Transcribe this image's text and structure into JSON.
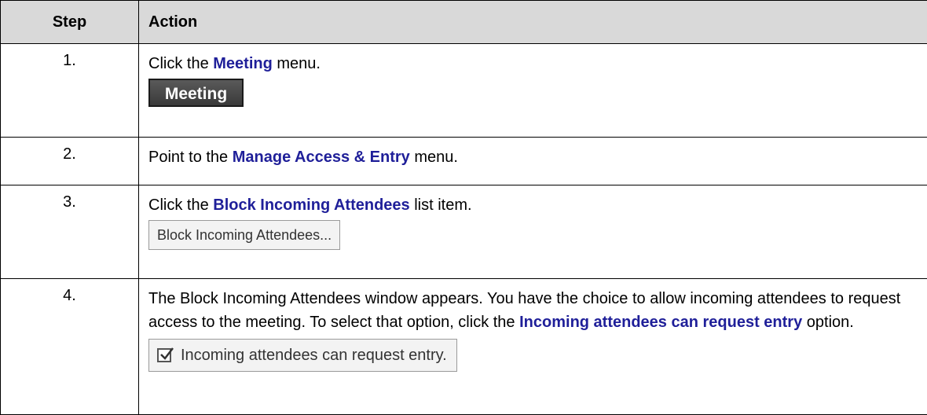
{
  "table": {
    "headers": {
      "step": "Step",
      "action": "Action"
    },
    "rows": [
      {
        "step": "1.",
        "pre": "Click the ",
        "highlight": "Meeting",
        "post": " menu.",
        "widget_label": "Meeting"
      },
      {
        "step": "2.",
        "pre": "Point to the ",
        "highlight": "Manage Access & Entry",
        "post": " menu."
      },
      {
        "step": "3.",
        "pre": "Click the ",
        "highlight": "Block Incoming Attendees",
        "post": " list item.",
        "widget_label": "Block Incoming Attendees..."
      },
      {
        "step": "4.",
        "pre": "The Block Incoming Attendees window appears.  You have the choice to allow incoming attendees to request access to the meeting.  To select that option, click the ",
        "highlight": "Incoming attendees can request entry",
        "post": " option.",
        "widget_label": "Incoming attendees can request entry.",
        "widget_checked": true
      }
    ]
  },
  "colors": {
    "highlight": "#1f1f99",
    "header_bg": "#d9d9d9"
  }
}
